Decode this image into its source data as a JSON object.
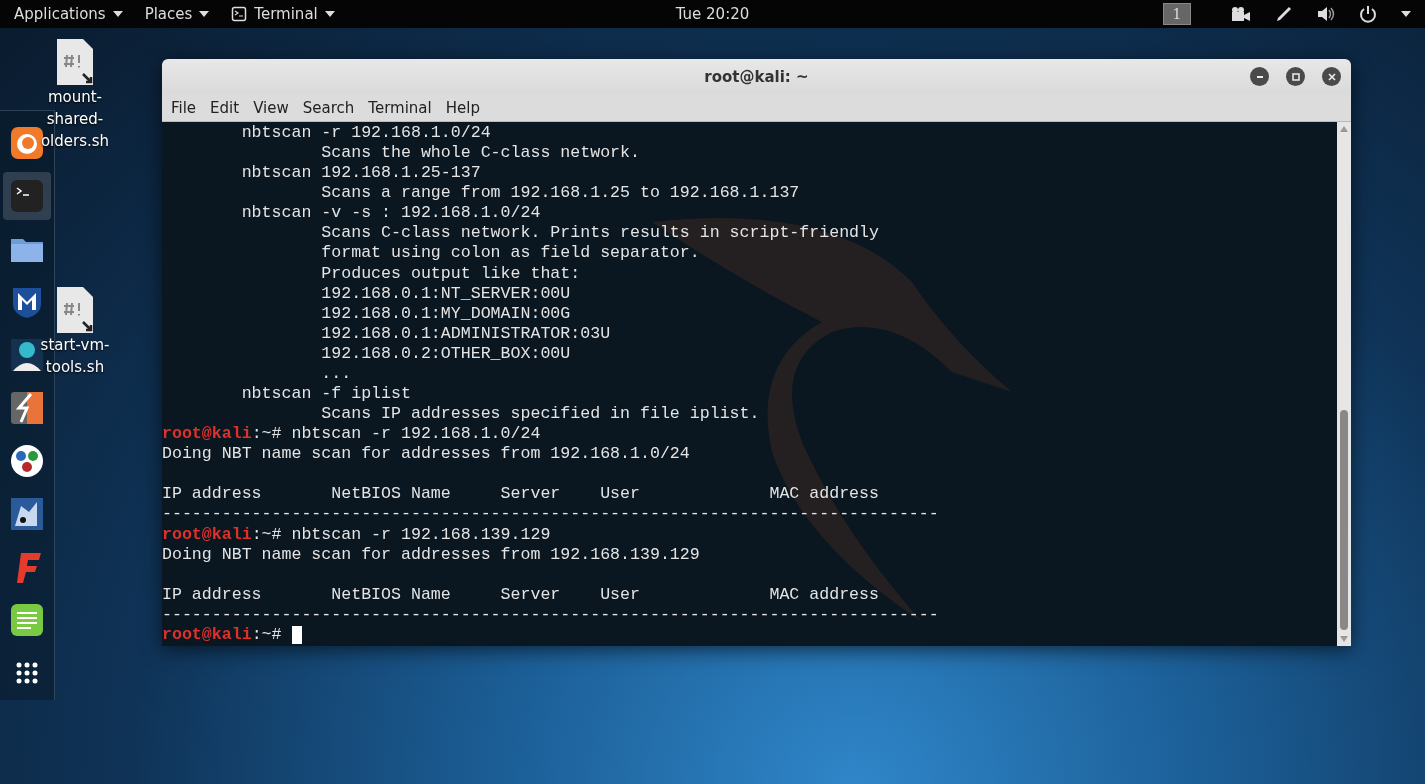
{
  "top_bar": {
    "menus": [
      {
        "label": "Applications",
        "kind": "plain"
      },
      {
        "label": "Places",
        "kind": "plain"
      },
      {
        "label": "Terminal",
        "kind": "terminal"
      }
    ],
    "clock": "Tue 20:20",
    "workspace": "1"
  },
  "dock": {
    "items": [
      {
        "kind": "firefox",
        "selected": false
      },
      {
        "kind": "terminal",
        "selected": true
      },
      {
        "kind": "folder",
        "selected": false
      },
      {
        "kind": "shield",
        "selected": false
      },
      {
        "kind": "person",
        "selected": false
      },
      {
        "kind": "bolt",
        "selected": false
      },
      {
        "kind": "dots",
        "selected": false
      },
      {
        "kind": "wolf",
        "selected": false
      },
      {
        "kind": "letter-f",
        "selected": false
      },
      {
        "kind": "notes",
        "selected": false
      },
      {
        "kind": "grid",
        "selected": false
      }
    ]
  },
  "desktop_icons": [
    {
      "lines": [
        "mount-",
        "shared-",
        "olders.sh"
      ]
    },
    {
      "lines": [
        "start-vm-",
        "tools.sh"
      ]
    }
  ],
  "window": {
    "title": "root@kali: ~",
    "menu": [
      "File",
      "Edit",
      "View",
      "Search",
      "Terminal",
      "Help"
    ]
  },
  "terminal": {
    "lines": [
      {
        "kind": "text",
        "text": "        nbtscan -r 192.168.1.0/24"
      },
      {
        "kind": "text",
        "text": "                Scans the whole C-class network."
      },
      {
        "kind": "text",
        "text": "        nbtscan 192.168.1.25-137"
      },
      {
        "kind": "text",
        "text": "                Scans a range from 192.168.1.25 to 192.168.1.137"
      },
      {
        "kind": "text",
        "text": "        nbtscan -v -s : 192.168.1.0/24"
      },
      {
        "kind": "text",
        "text": "                Scans C-class network. Prints results in script-friendly"
      },
      {
        "kind": "text",
        "text": "                format using colon as field separator."
      },
      {
        "kind": "text",
        "text": "                Produces output like that:"
      },
      {
        "kind": "text",
        "text": "                192.168.0.1:NT_SERVER:00U"
      },
      {
        "kind": "text",
        "text": "                192.168.0.1:MY_DOMAIN:00G"
      },
      {
        "kind": "text",
        "text": "                192.168.0.1:ADMINISTRATOR:03U"
      },
      {
        "kind": "text",
        "text": "                192.168.0.2:OTHER_BOX:00U"
      },
      {
        "kind": "text",
        "text": "                ..."
      },
      {
        "kind": "text",
        "text": "        nbtscan -f iplist"
      },
      {
        "kind": "text",
        "text": "                Scans IP addresses specified in file iplist."
      },
      {
        "kind": "prompt",
        "user": "root@kali",
        "text": ":~# nbtscan -r 192.168.1.0/24",
        "cursor": false
      },
      {
        "kind": "text",
        "text": "Doing NBT name scan for addresses from 192.168.1.0/24"
      },
      {
        "kind": "blank"
      },
      {
        "kind": "text",
        "text": "IP address       NetBIOS Name     Server    User             MAC address"
      },
      {
        "kind": "text",
        "text": "------------------------------------------------------------------------------"
      },
      {
        "kind": "prompt",
        "user": "root@kali",
        "text": ":~# nbtscan -r 192.168.139.129",
        "cursor": false
      },
      {
        "kind": "text",
        "text": "Doing NBT name scan for addresses from 192.168.139.129"
      },
      {
        "kind": "blank"
      },
      {
        "kind": "text",
        "text": "IP address       NetBIOS Name     Server    User             MAC address"
      },
      {
        "kind": "text",
        "text": "------------------------------------------------------------------------------"
      },
      {
        "kind": "prompt",
        "user": "root@kali",
        "text": ":~#",
        "cursor": true
      }
    ]
  }
}
